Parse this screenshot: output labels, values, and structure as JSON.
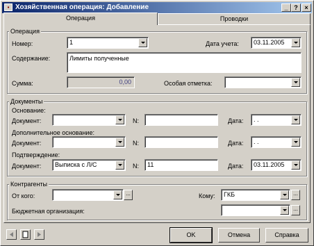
{
  "window": {
    "title": "Хозяйственная операция: Добавление",
    "minimize": "_",
    "help": "?",
    "close": "×"
  },
  "tabs": [
    {
      "label": "Операция"
    },
    {
      "label": "Проводки"
    }
  ],
  "operation": {
    "group_title": "Операция",
    "number_label": "Номер:",
    "number_value": "1",
    "date_label": "Дата учета:",
    "date_value": "03.11.2005",
    "content_label": "Содержание:",
    "content_value": "Лимиты полученные",
    "sum_label": "Сумма:",
    "sum_value": "0,00",
    "special_label": "Особая отметка:",
    "special_value": ""
  },
  "documents": {
    "group_title": "Документы",
    "basis": {
      "section_label": "Основание:",
      "doc_label": "Документ:",
      "doc_value": "",
      "n_label": "N:",
      "n_value": "",
      "date_label": "Дата:",
      "date_value": ". ."
    },
    "additional": {
      "section_label": "Дополнительное основание:",
      "doc_label": "Документ:",
      "doc_value": "",
      "n_label": "N:",
      "n_value": "",
      "date_label": "Дата:",
      "date_value": ". ."
    },
    "confirmation": {
      "section_label": "Подтверждение:",
      "doc_label": "Документ:",
      "doc_value": "Выписка с Л/С",
      "n_label": "N:",
      "n_value": "11",
      "date_label": "Дата:",
      "date_value": "03.11.2005"
    }
  },
  "counterparties": {
    "group_title": "Контрагенты",
    "from_label": "От кого:",
    "from_value": "",
    "to_label": "Кому:",
    "to_value": "ГКБ",
    "budget_label": "Бюджетная организация:",
    "budget_value": ""
  },
  "footer": {
    "ok": "OK",
    "cancel": "Отмена",
    "help": "Справка"
  },
  "icons": {
    "dots_glyph": "...",
    "prev": "arrow-left-icon",
    "doc": "document-icon",
    "next": "arrow-right-icon"
  }
}
